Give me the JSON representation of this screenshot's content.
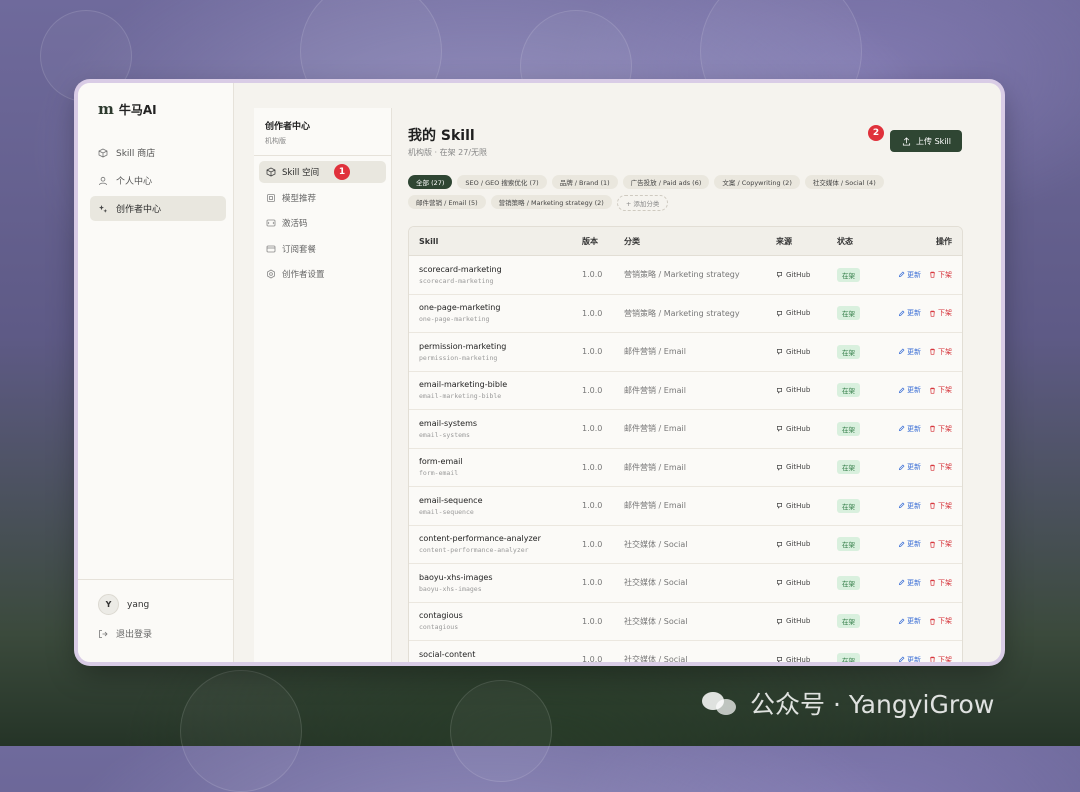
{
  "app": {
    "logo_mark": "m",
    "name": "牛马AI"
  },
  "sidebar": {
    "items": [
      {
        "label": "Skill 商店",
        "icon": "cube-icon"
      },
      {
        "label": "个人中心",
        "icon": "user-icon"
      },
      {
        "label": "创作者中心",
        "icon": "sparkle-icon",
        "active": true
      }
    ],
    "user": {
      "initial": "Y",
      "name": "yang"
    },
    "logout": "退出登录"
  },
  "panel": {
    "title": "创作者中心",
    "subtitle": "机构版",
    "items": [
      {
        "label": "Skill 空间",
        "icon": "cube-icon",
        "active": true
      },
      {
        "label": "模型推荐",
        "icon": "model-icon"
      },
      {
        "label": "激活码",
        "icon": "code-icon"
      },
      {
        "label": "订阅套餐",
        "icon": "card-icon"
      },
      {
        "label": "创作者设置",
        "icon": "settings-icon"
      }
    ]
  },
  "annotations": {
    "one": "1",
    "two": "2"
  },
  "main": {
    "title": "我的 Skill",
    "subtitle": "机构版 · 在架 27/无限",
    "upload_label": "上传 Skill",
    "filters_row1": [
      "全部 (27)",
      "SEO / GEO 搜索优化 (7)",
      "品牌 / Brand (1)",
      "广告投放 / Paid ads (6)",
      "文案 / Copywriting (2)",
      "社交媒体 / Social (4)"
    ],
    "filters_row2": [
      "邮件营销 / Email (5)",
      "营销策略 / Marketing strategy (2)"
    ],
    "add_category": "+ 添加分类",
    "table": {
      "headers": {
        "skill": "Skill",
        "version": "版本",
        "category": "分类",
        "source": "来源",
        "status": "状态",
        "ops": "操作"
      },
      "rows": [
        {
          "name": "scorecard-marketing",
          "slug": "scorecard-marketing",
          "version": "1.0.0",
          "category": "营销策略 / Marketing strategy",
          "source": "GitHub",
          "status": "在架"
        },
        {
          "name": "one-page-marketing",
          "slug": "one-page-marketing",
          "version": "1.0.0",
          "category": "营销策略 / Marketing strategy",
          "source": "GitHub",
          "status": "在架"
        },
        {
          "name": "permission-marketing",
          "slug": "permission-marketing",
          "version": "1.0.0",
          "category": "邮件营销 / Email",
          "source": "GitHub",
          "status": "在架"
        },
        {
          "name": "email-marketing-bible",
          "slug": "email-marketing-bible",
          "version": "1.0.0",
          "category": "邮件营销 / Email",
          "source": "GitHub",
          "status": "在架"
        },
        {
          "name": "email-systems",
          "slug": "email-systems",
          "version": "1.0.0",
          "category": "邮件营销 / Email",
          "source": "GitHub",
          "status": "在架"
        },
        {
          "name": "form-email",
          "slug": "form-email",
          "version": "1.0.0",
          "category": "邮件营销 / Email",
          "source": "GitHub",
          "status": "在架"
        },
        {
          "name": "email-sequence",
          "slug": "email-sequence",
          "version": "1.0.0",
          "category": "邮件营销 / Email",
          "source": "GitHub",
          "status": "在架"
        },
        {
          "name": "content-performance-analyzer",
          "slug": "content-performance-analyzer",
          "version": "1.0.0",
          "category": "社交媒体 / Social",
          "source": "GitHub",
          "status": "在架"
        },
        {
          "name": "baoyu-xhs-images",
          "slug": "baoyu-xhs-images",
          "version": "1.0.0",
          "category": "社交媒体 / Social",
          "source": "GitHub",
          "status": "在架"
        },
        {
          "name": "contagious",
          "slug": "contagious",
          "version": "1.0.0",
          "category": "社交媒体 / Social",
          "source": "GitHub",
          "status": "在架"
        },
        {
          "name": "social-content",
          "slug": "social-content",
          "version": "1.0.0",
          "category": "社交媒体 / Social",
          "source": "GitHub",
          "status": "在架"
        }
      ],
      "op_update": "更新",
      "op_offline": "下架"
    }
  },
  "watermark": "公众号 · YangyiGrow"
}
